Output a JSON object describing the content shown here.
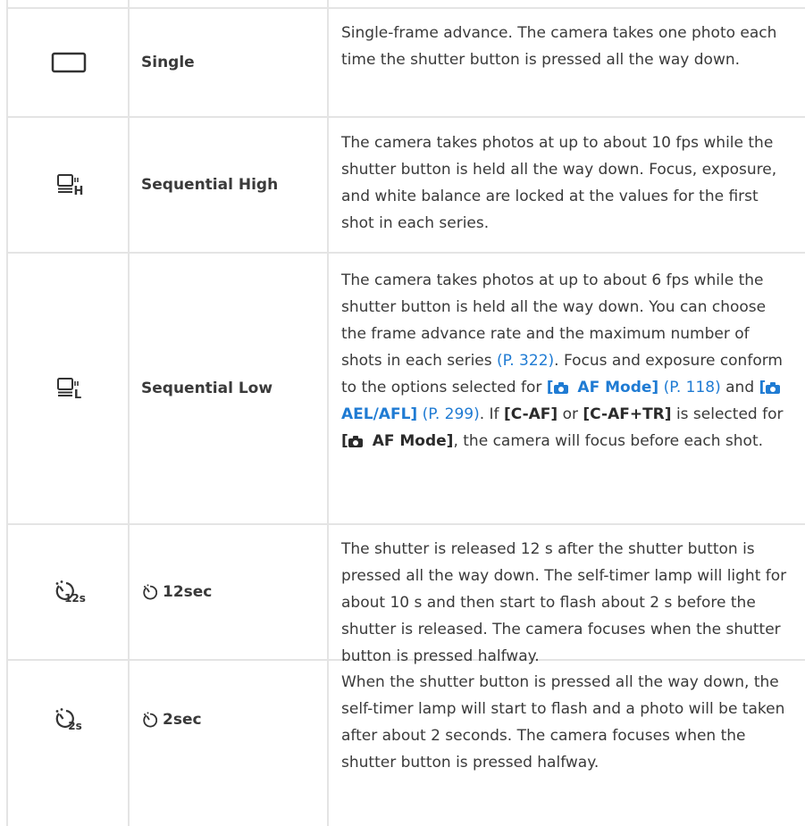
{
  "rows": [
    {
      "icon": "single-frame-icon",
      "name": "Single",
      "desc": [
        "Single-frame advance. The camera takes one photo each time the shutter button is pressed all the way down."
      ]
    },
    {
      "icon": "sequential-high-icon",
      "name": "Sequential High",
      "desc": [
        "The camera takes photos at up to about 10 fps while the shutter button is held all the way down. Focus, exposure, and white balance are locked at the values for the first shot in each series."
      ]
    },
    {
      "icon": "sequential-low-icon",
      "name": "Sequential Low",
      "desc_parts": {
        "p1": "The camera takes photos at up to about 6 fps while the shutter button is held all the way down. You can choose the frame advance rate and the maximum number of shots in each series ",
        "ref1": "(P. 322)",
        "p2": ". Focus and exposure conform to the options selected for ",
        "opt1_open": "[",
        "opt1_text": " AF Mode]",
        "ref2": "(P. 118)",
        "and": " and ",
        "opt2_open": "[",
        "opt2_text": " AEL/AFL]",
        "ref3": "(P. 299)",
        "p3": ". If ",
        "caf": "[C-AF]",
        "or": " or ",
        "caftr": "[C-AF+TR]",
        "p4": " is selected for ",
        "opt3_open": "[",
        "opt3_text": " AF Mode]",
        "p5": ", the camera will focus before each shot."
      }
    },
    {
      "icon": "self-timer-12s-icon",
      "name": "12sec",
      "desc": [
        "The shutter is released 12 s after the shutter button is pressed all the way down. The self-timer lamp will light for about 10 s and then start to flash about 2 s before the shutter is released. The camera focuses when the shutter button is pressed halfway."
      ]
    },
    {
      "icon": "self-timer-2s-icon",
      "name": "2sec",
      "desc": [
        "When the shutter button is pressed all the way down, the self-timer lamp will start to flash and a photo will be taken after about 2 seconds. The camera focuses when the shutter button is pressed halfway."
      ]
    }
  ],
  "icon_labels": {
    "seq_high_letter": "H",
    "seq_low_letter": "L",
    "timer12": "12s",
    "timer2": "2s"
  },
  "colors": {
    "link": "#1f7bd3",
    "grid": "#e4e4e4",
    "text": "#3a3a3a"
  }
}
